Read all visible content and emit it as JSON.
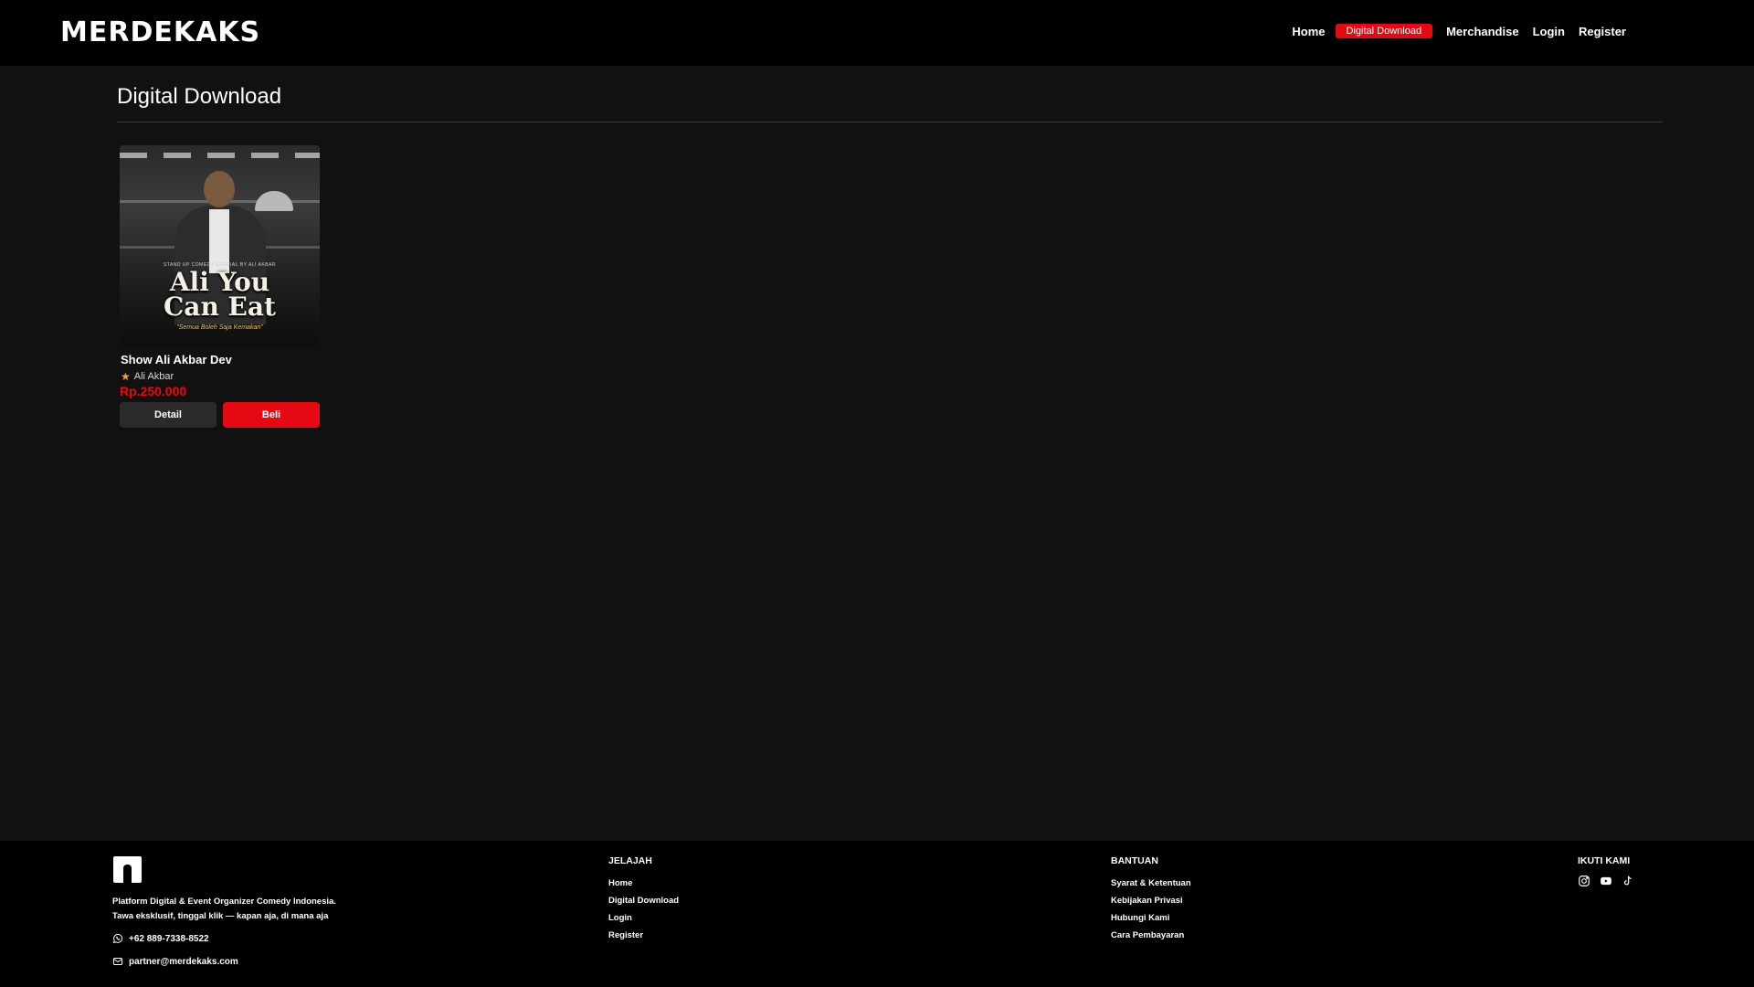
{
  "header": {
    "logo": "MERDEKAKS",
    "nav": [
      {
        "label": "Home"
      },
      {
        "label": "Digital Download"
      },
      {
        "label": "Merchandise"
      },
      {
        "label": "Login"
      },
      {
        "label": "Register"
      }
    ]
  },
  "main": {
    "title": "Digital Download",
    "products": [
      {
        "poster_small": "STAND UP COMEDY SPECIAL BY ALI AKBAR",
        "poster_title_1": "Ali You",
        "poster_title_2": "Can Eat",
        "poster_tag": "\"Semua Boleh Saja Kemakan\"",
        "title": "Show Ali Akbar Dev",
        "artist": "Ali Akbar",
        "price": "Rp.250.000",
        "detail_label": "Detail",
        "buy_label": "Beli"
      }
    ]
  },
  "footer": {
    "desc_line1": "Platform Digital & Event Organizer Comedy Indonesia.",
    "desc_line2": "Tawa eksklusif, tinggal klik — kapan aja, di mana aja",
    "phone": "+62 889-7338-8522",
    "email": "partner@merdekaks.com",
    "explore": {
      "heading": "JELAJAH",
      "links": [
        "Home",
        "Digital Download",
        "Login",
        "Register"
      ]
    },
    "help": {
      "heading": "BANTUAN",
      "links": [
        "Syarat & Ketentuan",
        "Kebijakan Privasi",
        "Hubungi Kami",
        "Cara Pembayaran"
      ]
    },
    "follow": {
      "heading": "IKUTI KAMI",
      "icons": [
        "instagram-icon",
        "youtube-icon",
        "tiktok-icon"
      ]
    }
  },
  "colors": {
    "accent": "#e50914",
    "background": "#111111",
    "header": "#000000",
    "star": "#f5a623"
  }
}
